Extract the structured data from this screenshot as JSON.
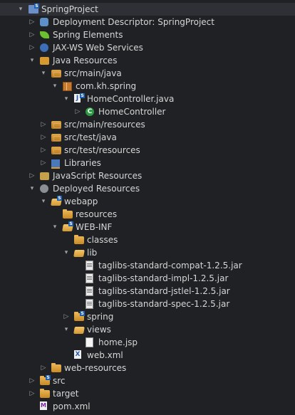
{
  "explorer": {
    "items": [
      {
        "label": "SpringProject",
        "icon": "project-icon",
        "arrow": "▾",
        "level": 0,
        "root": true
      },
      {
        "label": "Deployment Descriptor: SpringProject",
        "icon": "deployment-descriptor-icon",
        "arrow": "▷",
        "level": 1
      },
      {
        "label": "Spring Elements",
        "icon": "spring-leaf-icon",
        "arrow": "▷",
        "level": 1
      },
      {
        "label": "JAX-WS Web Services",
        "icon": "web-services-icon",
        "arrow": "▷",
        "level": 1
      },
      {
        "label": "Java Resources",
        "icon": "java-resources-icon",
        "arrow": "▾",
        "level": 1
      },
      {
        "label": "src/main/java",
        "icon": "source-folder-icon",
        "arrow": "▾",
        "level": 2
      },
      {
        "label": "com.kh.spring",
        "icon": "package-icon",
        "arrow": "▾",
        "level": 3
      },
      {
        "label": "HomeController.java",
        "icon": "java-file-icon",
        "arrow": "▾",
        "level": 4
      },
      {
        "label": "HomeController",
        "icon": "class-icon",
        "arrow": "▷",
        "level": 5
      },
      {
        "label": "src/main/resources",
        "icon": "source-folder-icon",
        "arrow": "▷",
        "level": 2
      },
      {
        "label": "src/test/java",
        "icon": "source-folder-icon",
        "arrow": "▷",
        "level": 2
      },
      {
        "label": "src/test/resources",
        "icon": "source-folder-icon",
        "arrow": "▷",
        "level": 2
      },
      {
        "label": "Libraries",
        "icon": "libraries-icon",
        "arrow": "▷",
        "level": 2
      },
      {
        "label": "JavaScript Resources",
        "icon": "javascript-resources-icon",
        "arrow": "▷",
        "level": 1
      },
      {
        "label": "Deployed Resources",
        "icon": "deployed-resources-icon",
        "arrow": "▾",
        "level": 1
      },
      {
        "label": "webapp",
        "icon": "folder-open-icon",
        "arrow": "▾",
        "level": 2
      },
      {
        "label": "resources",
        "icon": "folder-icon",
        "arrow": "",
        "level": 3
      },
      {
        "label": "WEB-INF",
        "icon": "folder-open-icon",
        "arrow": "▾",
        "level": 3
      },
      {
        "label": "classes",
        "icon": "folder-icon",
        "arrow": "",
        "level": 4
      },
      {
        "label": "lib",
        "icon": "folder-open-icon",
        "arrow": "▾",
        "level": 4
      },
      {
        "label": "taglibs-standard-compat-1.2.5.jar",
        "icon": "jar-icon",
        "arrow": "",
        "level": 5
      },
      {
        "label": "taglibs-standard-impl-1.2.5.jar",
        "icon": "jar-icon",
        "arrow": "",
        "level": 5
      },
      {
        "label": "taglibs-standard-jstlel-1.2.5.jar",
        "icon": "jar-icon",
        "arrow": "",
        "level": 5
      },
      {
        "label": "taglibs-standard-spec-1.2.5.jar",
        "icon": "jar-icon",
        "arrow": "",
        "level": 5
      },
      {
        "label": "spring",
        "icon": "folder-icon",
        "arrow": "▷",
        "level": 4
      },
      {
        "label": "views",
        "icon": "folder-open-icon",
        "arrow": "▾",
        "level": 4
      },
      {
        "label": "home.jsp",
        "icon": "file-icon",
        "arrow": "",
        "level": 5
      },
      {
        "label": "web.xml",
        "icon": "xml-file-icon",
        "arrow": "",
        "level": 4
      },
      {
        "label": "web-resources",
        "icon": "folder-icon",
        "arrow": "▷",
        "level": 2
      },
      {
        "label": "src",
        "icon": "folder-icon",
        "arrow": "▷",
        "level": 1
      },
      {
        "label": "target",
        "icon": "folder-icon",
        "arrow": "▷",
        "level": 1
      },
      {
        "label": "pom.xml",
        "icon": "maven-file-icon",
        "arrow": "",
        "level": 1
      }
    ]
  }
}
